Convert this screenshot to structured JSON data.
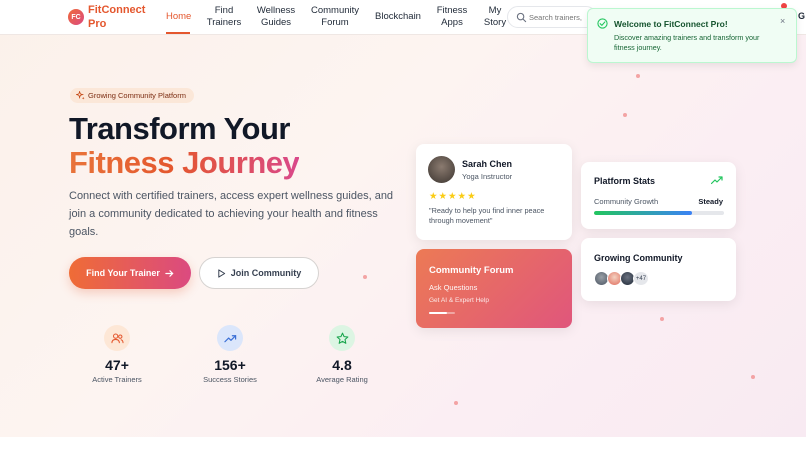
{
  "brand": {
    "logo_initials": "FC",
    "name_line1": "FitConnect",
    "name_line2": "Pro"
  },
  "nav": {
    "items": [
      {
        "line1": "Home",
        "line2": ""
      },
      {
        "line1": "Find",
        "line2": "Trainers"
      },
      {
        "line1": "Wellness",
        "line2": "Guides"
      },
      {
        "line1": "Community",
        "line2": "Forum"
      },
      {
        "line1": "Blockchain",
        "line2": ""
      },
      {
        "line1": "Fitness",
        "line2": "Apps"
      },
      {
        "line1": "My",
        "line2": "Story"
      }
    ],
    "search_placeholder": "Search trainers,",
    "edge_letter": "G"
  },
  "toast": {
    "title": "Welcome to FitConnect Pro!",
    "message": "Discover amazing trainers and transform your fitness journey.",
    "close_label": "×"
  },
  "hero": {
    "pill": "Growing Community Platform",
    "title_line1": "Transform Your",
    "title_line2": "Fitness Journey",
    "subtitle": "Connect with certified trainers, access expert wellness guides, and join a community dedicated to achieving your health and fitness goals.",
    "primary_cta": "Find Your Trainer",
    "secondary_cta": "Join Community"
  },
  "stats": [
    {
      "value": "47+",
      "label": "Active Trainers",
      "icon": "users-icon"
    },
    {
      "value": "156+",
      "label": "Success Stories",
      "icon": "trending-up-icon"
    },
    {
      "value": "4.8",
      "label": "Average Rating",
      "icon": "star-icon"
    }
  ],
  "trainer_card": {
    "name": "Sarah Chen",
    "role": "Yoga Instructor",
    "stars": "★★★★★",
    "quote": "\"Ready to help you find inner peace through movement\""
  },
  "forum_card": {
    "title": "Community Forum",
    "subtitle": "Ask Questions",
    "caption": "Get AI & Expert Help"
  },
  "platform_stats": {
    "title": "Platform Stats",
    "metric_label": "Community Growth",
    "metric_status": "Steady",
    "progress_fraction": 0.75
  },
  "growing_community": {
    "title": "Growing Community",
    "more_count": "+47"
  },
  "colors": {
    "accent": "#e4572e",
    "gradient_start": "#ef6c36",
    "gradient_end": "#db4a80",
    "success": "#22c55e"
  }
}
